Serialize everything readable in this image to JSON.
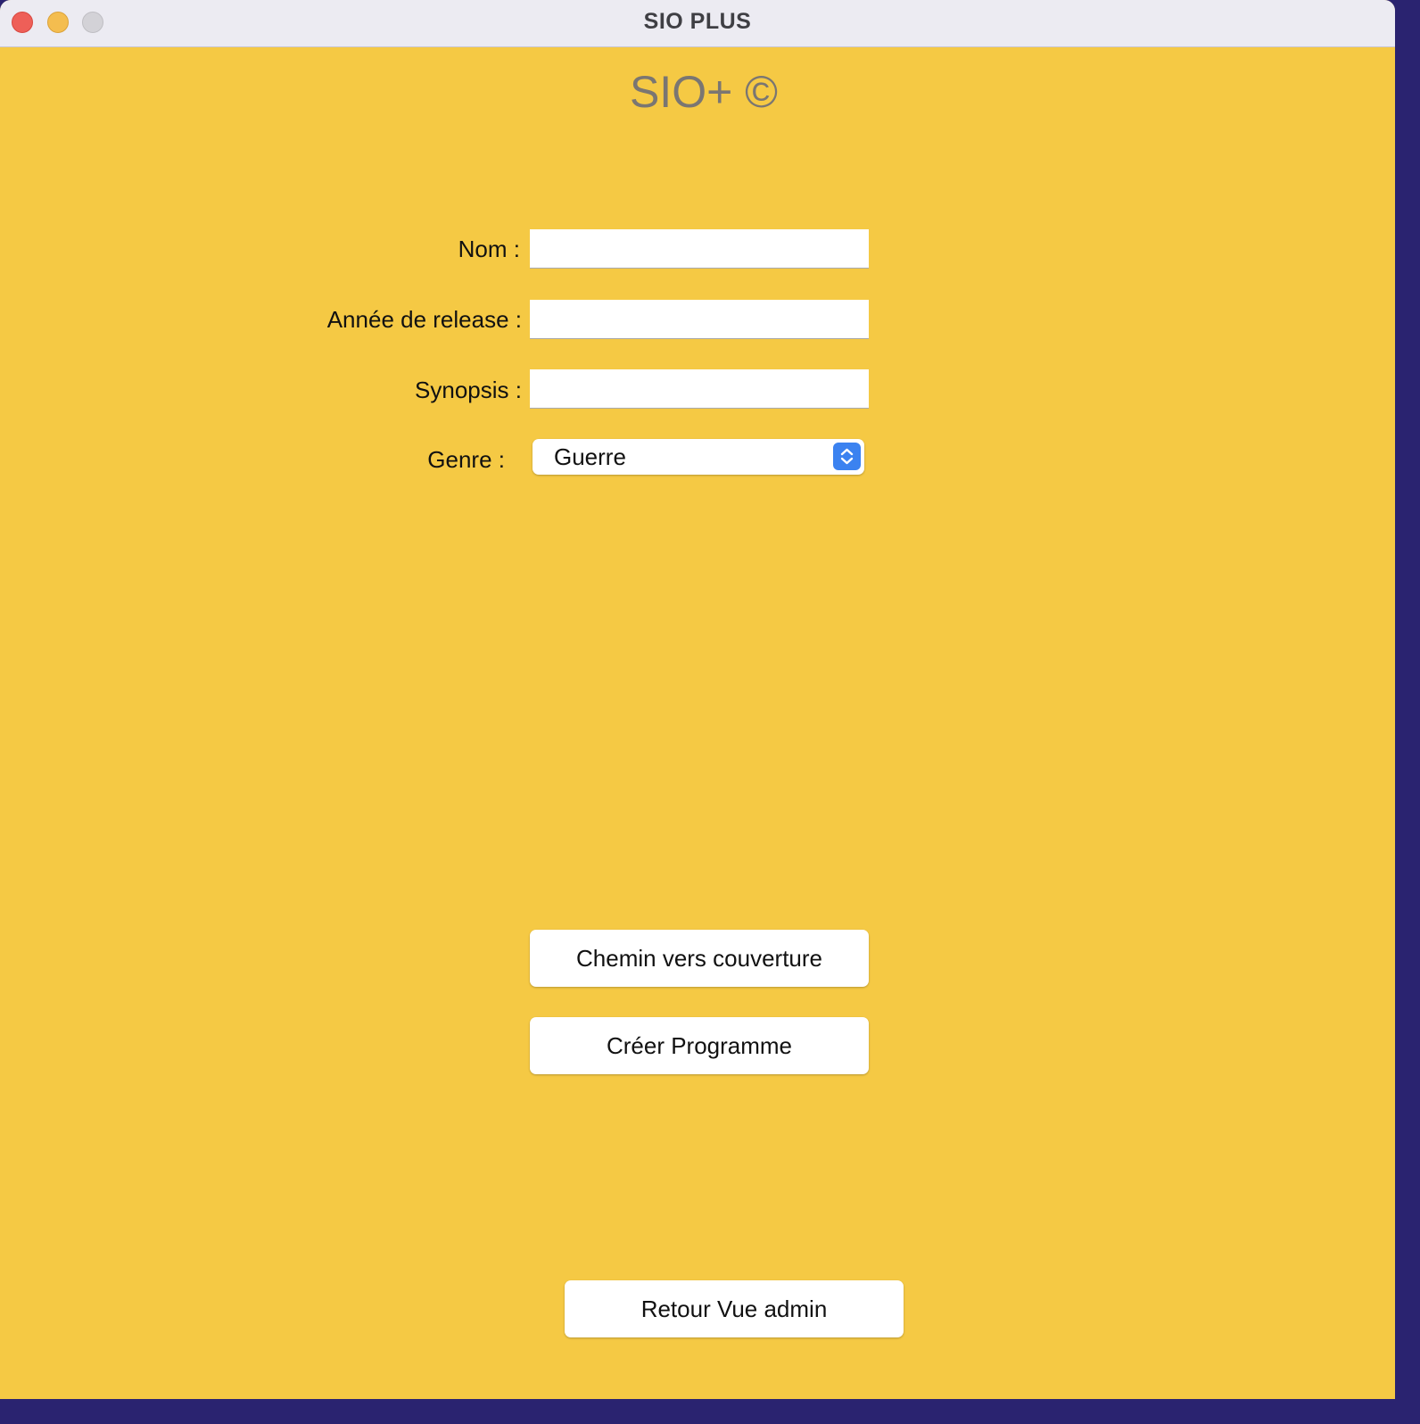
{
  "window": {
    "title": "SIO PLUS"
  },
  "app": {
    "title": "SIO+ ©"
  },
  "form": {
    "nom_label": "Nom :",
    "nom_value": "",
    "annee_label": "Année de release :",
    "annee_value": "",
    "synopsis_label": "Synopsis :",
    "synopsis_value": "",
    "genre_label": "Genre :",
    "genre_selected": "Guerre"
  },
  "buttons": {
    "cover_path": "Chemin vers couverture",
    "create_program": "Créer Programme",
    "back_admin": "Retour Vue admin"
  },
  "colors": {
    "background": "#f5c944",
    "accent": "#3b82f0"
  }
}
